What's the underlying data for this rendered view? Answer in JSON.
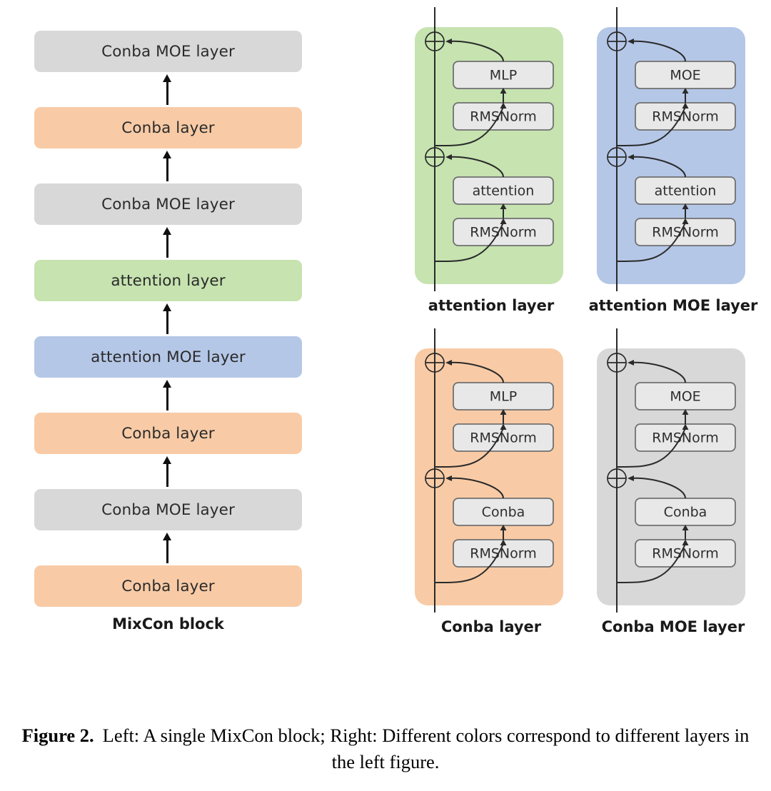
{
  "figure": {
    "caption_label": "Figure 2.",
    "caption_text": "Left: A single MixCon block; Right: Different colors correspond to different layers in the left figure."
  },
  "colors": {
    "orange": "#F8CBA6",
    "gray": "#D8D8D8",
    "green": "#C6E3B0",
    "blue": "#B5C7E7",
    "box_fill": "#E8E8E8",
    "box_stroke": "#707070",
    "line": "#2a2a2a",
    "text": "#2e2e2e"
  },
  "mixcon": {
    "title": "MixCon block",
    "layers": [
      {
        "label": "Conba MOE layer",
        "color": "#D8D8D8"
      },
      {
        "label": "Conba layer",
        "color": "#F8CBA6"
      },
      {
        "label": "Conba MOE layer",
        "color": "#D8D8D8"
      },
      {
        "label": "attention layer",
        "color": "#C6E3B0"
      },
      {
        "label": "attention MOE layer",
        "color": "#B5C7E7"
      },
      {
        "label": "Conba layer",
        "color": "#F8CBA6"
      },
      {
        "label": "Conba MOE layer",
        "color": "#D8D8D8"
      },
      {
        "label": "Conba layer",
        "color": "#F8CBA6"
      }
    ],
    "arrow_icon": "up-arrow-icon"
  },
  "subblocks": [
    {
      "id": "attention",
      "title": "attention layer",
      "panel_color": "#C6E3B0",
      "blocks": {
        "top_module": "MLP",
        "top_norm": "RMSNorm",
        "bottom_module": "attention",
        "bottom_norm": "RMSNorm"
      },
      "residual_icon": "circled-plus-icon"
    },
    {
      "id": "attention-moe",
      "title": "attention MOE layer",
      "panel_color": "#B5C7E7",
      "blocks": {
        "top_module": "MOE",
        "top_norm": "RMSNorm",
        "bottom_module": "attention",
        "bottom_norm": "RMSNorm"
      },
      "residual_icon": "circled-plus-icon"
    },
    {
      "id": "conba",
      "title": "Conba layer",
      "panel_color": "#F8CBA6",
      "blocks": {
        "top_module": "MLP",
        "top_norm": "RMSNorm",
        "bottom_module": "Conba",
        "bottom_norm": "RMSNorm"
      },
      "residual_icon": "circled-plus-icon"
    },
    {
      "id": "conba-moe",
      "title": "Conba MOE layer",
      "panel_color": "#D8D8D8",
      "blocks": {
        "top_module": "MOE",
        "top_norm": "RMSNorm",
        "bottom_module": "Conba",
        "bottom_norm": "RMSNorm"
      },
      "residual_icon": "circled-plus-icon"
    }
  ]
}
